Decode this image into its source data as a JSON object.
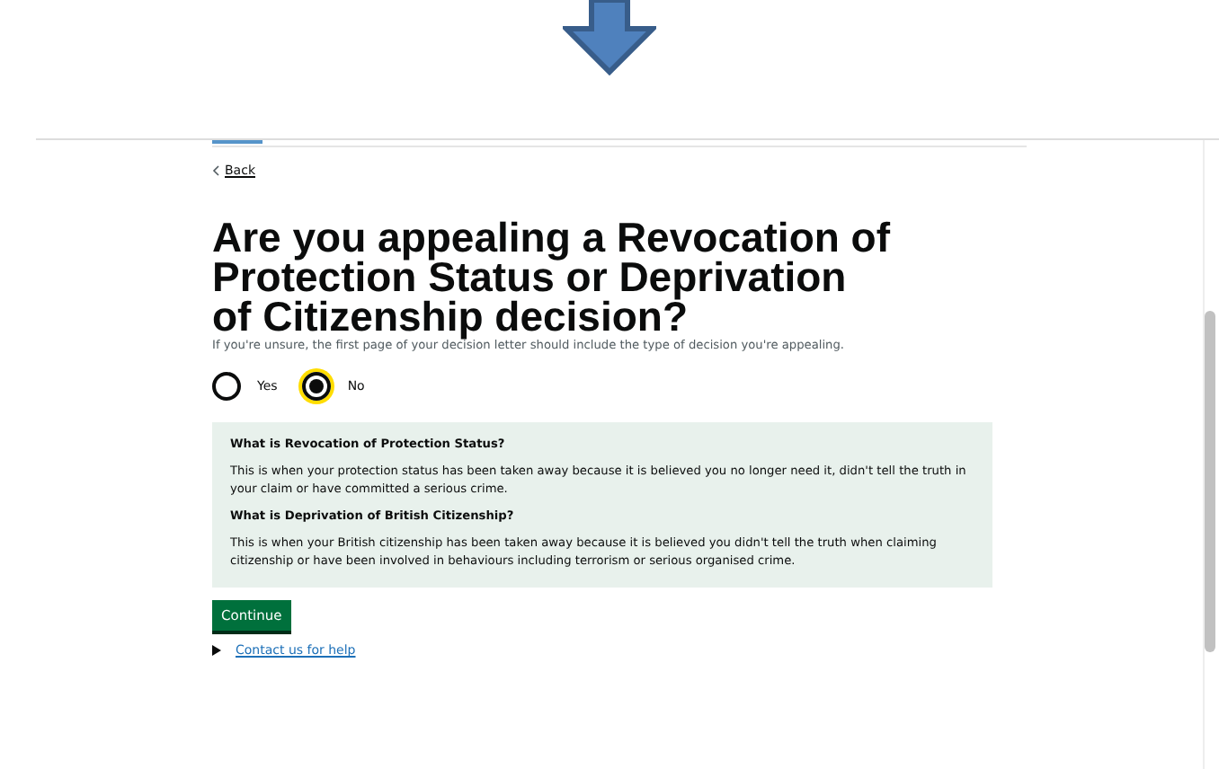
{
  "back_link": "Back",
  "heading": "Are you appealing a Revocation of Protection Status or Deprivation of Citizenship decision?",
  "hint": "If you're unsure, the first page of your decision letter should include the type of decision you're appealing.",
  "options": [
    {
      "label": "Yes",
      "selected": false
    },
    {
      "label": "No",
      "selected": true
    }
  ],
  "info_panel": [
    {
      "kind": "heading",
      "text": "What is Revocation of Protection Status?"
    },
    {
      "kind": "paragraph",
      "text": "This is when your protection status has been taken away because it is believed you no longer need it, didn't tell the truth in your claim or have committed a serious crime."
    },
    {
      "kind": "heading",
      "text": "What is Deprivation of British Citizenship?"
    },
    {
      "kind": "paragraph",
      "text": "This is when your British citizenship has been taken away because it is believed you didn't tell the truth when claiming citizenship or have been involved in behaviours including terrorism or serious organised crime."
    }
  ],
  "continue_button": "Continue",
  "help_link": "Contact us for help"
}
